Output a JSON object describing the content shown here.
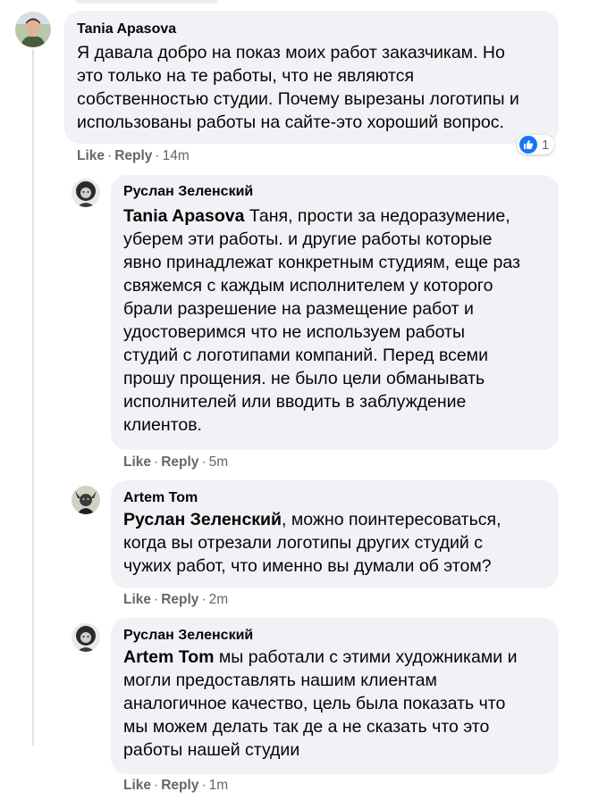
{
  "colors": {
    "bubble": "#f0f2f5",
    "meta": "#65676b",
    "like_blue": "#1877f2"
  },
  "labels": {
    "like": "Like",
    "reply": "Reply",
    "separator": "·"
  },
  "comments": [
    {
      "author": "Tania Apasova",
      "lines": [
        "Я давала добро на показ моих работ заказчикам. Но",
        "это только на те работы, что не являются",
        "собственностью студии. Почему вырезаны логотипы и",
        "использованы работы на сайте-это хороший вопрос."
      ],
      "time": "14m",
      "reaction_count": "1",
      "reaction_icon": "like-icon"
    },
    {
      "author": "Руслан Зеленский",
      "mention": "Tania Apasova",
      "first_line_rest": " Таня, прости за недоразумение,",
      "lines": [
        "уберем эти работы. и другие работы которые",
        "явно принадлежат конкретным студиям, еще раз",
        "свяжемся с каждым исполнителем у которого",
        "брали разрешение на размещение работ и",
        "удостоверимся что не используем работы",
        "студий с логотипами компаний. Перед всеми",
        "прошу прощения. не было цели обманывать",
        "исполнителей или вводить в заблуждение",
        "клиентов."
      ],
      "time": "5m"
    },
    {
      "author": "Artem Tom",
      "mention": "Руслан Зеленский",
      "first_line_rest": ", можно поинтересоваться,",
      "lines": [
        "когда вы отрезали логотипы других студий с",
        "чужих работ, что именно вы думали об этом?"
      ],
      "time": "2m"
    },
    {
      "author": "Руслан Зеленский",
      "mention": "Artem Tom",
      "first_line_rest": " мы работали с этими художниками и",
      "lines": [
        "могли предоставлять нашим клиентам",
        "аналогичное качество, цель была показать что",
        "мы можем делать так де а не сказать что это",
        "работы нашей студии"
      ],
      "time": "1m"
    }
  ]
}
